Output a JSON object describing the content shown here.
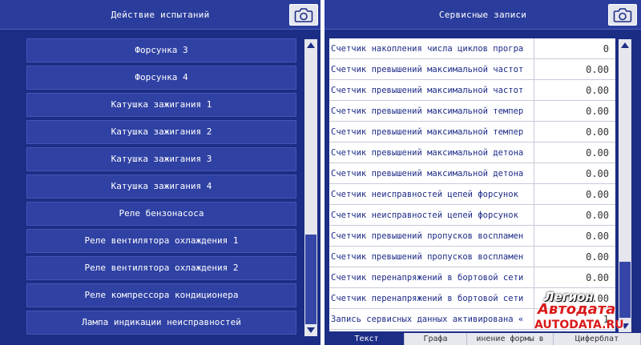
{
  "left_panel": {
    "title": "Действие испытаний",
    "camera_icon": "camera-icon",
    "items": [
      {
        "label": "Форсунка 3"
      },
      {
        "label": "Форсунка 4"
      },
      {
        "label": "Катушка зажигания 1"
      },
      {
        "label": "Катушка зажигания 2"
      },
      {
        "label": "Катушка зажигания 3"
      },
      {
        "label": "Катушка зажигания 4"
      },
      {
        "label": "Реле бензонасоса"
      },
      {
        "label": "Реле вентилятора охлаждения 1"
      },
      {
        "label": "Реле вентилятора охлаждения 2"
      },
      {
        "label": "Реле компрессора кондиционера"
      },
      {
        "label": "Лампа индикации неисправностей"
      }
    ]
  },
  "right_panel": {
    "title": "Сервисные записи",
    "camera_icon": "camera-icon",
    "records": [
      {
        "label": "Счетчик накопления числа циклов програ",
        "value": "0"
      },
      {
        "label": "Счетчик превышений максимальной частот",
        "value": "0.00"
      },
      {
        "label": "Счетчик превышений максимальной частот",
        "value": "0.00"
      },
      {
        "label": "Счетчик превышений максимальной темпер",
        "value": "0.00"
      },
      {
        "label": "Счетчик превышений максимальной темпер",
        "value": "0.00"
      },
      {
        "label": "Счетчик превышений максимальной детона",
        "value": "0.00"
      },
      {
        "label": "Счетчик превышений максимальной детона",
        "value": "0.00"
      },
      {
        "label": "Счетчик неисправностей цепей форсунок",
        "value": "0.00"
      },
      {
        "label": "Счетчик неисправностей цепей форсунок",
        "value": "0.00"
      },
      {
        "label": "Счетчик превышений пропусков воспламен",
        "value": "0.00"
      },
      {
        "label": "Счетчик превышений пропусков воспламен",
        "value": "0.00"
      },
      {
        "label": "Счетчик перенапряжений в бортовой сети",
        "value": "0.00"
      },
      {
        "label": "Счетчик перенапряжений в бортовой сети",
        "value": "0.00"
      },
      {
        "label": "Запись сервисных данных активирована «",
        "value": "1"
      }
    ],
    "tabs": [
      {
        "label": "Текст"
      },
      {
        "label": "Графа"
      },
      {
        "label": "инение формы в"
      },
      {
        "label": "Циферблат"
      }
    ],
    "active_tab": "Текст"
  },
  "watermark": {
    "line1": "Легион",
    "line2": "Автодата",
    "line3": "AUTODATA.RU"
  },
  "colors": {
    "panel_bg": "#1c2d86",
    "header_bg": "#2a3d9c",
    "button_bg": "#2f41a3",
    "scroll_thumb": "#3546a8",
    "record_text": "#1c2a86",
    "watermark_red": "#d91a1a"
  }
}
